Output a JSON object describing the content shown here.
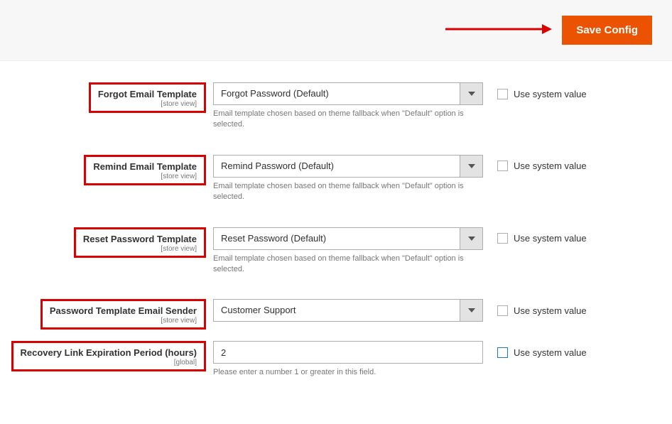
{
  "toolbar": {
    "save_label": "Save Config"
  },
  "fields": {
    "forgot": {
      "label": "Forgot Email Template",
      "scope": "[store view]",
      "value": "Forgot Password (Default)",
      "help": "Email template chosen based on theme fallback when \"Default\" option is selected.",
      "use_system_label": "Use system value"
    },
    "remind": {
      "label": "Remind Email Template",
      "scope": "[store view]",
      "value": "Remind Password (Default)",
      "help": "Email template chosen based on theme fallback when \"Default\" option is selected.",
      "use_system_label": "Use system value"
    },
    "reset": {
      "label": "Reset Password Template",
      "scope": "[store view]",
      "value": "Reset Password (Default)",
      "help": "Email template chosen based on theme fallback when \"Default\" option is selected.",
      "use_system_label": "Use system value"
    },
    "sender": {
      "label": "Password Template Email Sender",
      "scope": "[store view]",
      "value": "Customer Support",
      "use_system_label": "Use system value"
    },
    "recovery": {
      "label": "Recovery Link Expiration Period (hours)",
      "scope": "[global]",
      "value": "2",
      "help": "Please enter a number 1 or greater in this field.",
      "use_system_label": "Use system value"
    }
  }
}
